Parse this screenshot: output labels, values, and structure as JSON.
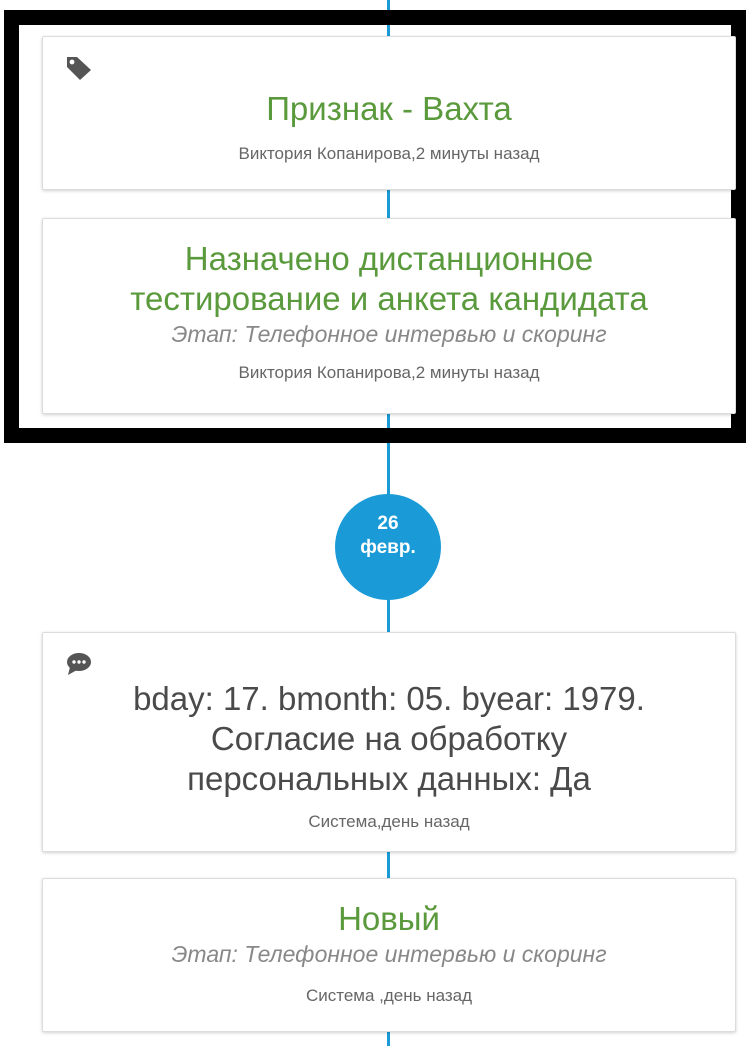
{
  "colors": {
    "timeline": "#1a9bd7",
    "title_green": "#5a9a3c",
    "highlight_border": "#000000"
  },
  "events": [
    {
      "icon": "tag-icon",
      "title": "Признак - Вахта",
      "meta": "Виктория Копанирова,2 минуты назад"
    },
    {
      "title_line1": "Назначено дистанционное",
      "title_line2": "тестирование и анкета кандидата",
      "stage": "Этап: Телефонное интервью и скоринг",
      "meta": "Виктория Копанирова,2 минуты назад"
    },
    {
      "icon": "comment-icon",
      "text_line1": "bday: 17. bmonth: 05. byear: 1979.",
      "text_line2": "Согласие на обработку",
      "text_line3": "персональных данных: Да",
      "meta": "Система,день назад"
    },
    {
      "title": "Новый",
      "stage": "Этап: Телефонное интервью и скоринг",
      "meta": "Система ,день назад"
    }
  ],
  "date_marker": {
    "day": "26",
    "month": "февр."
  }
}
